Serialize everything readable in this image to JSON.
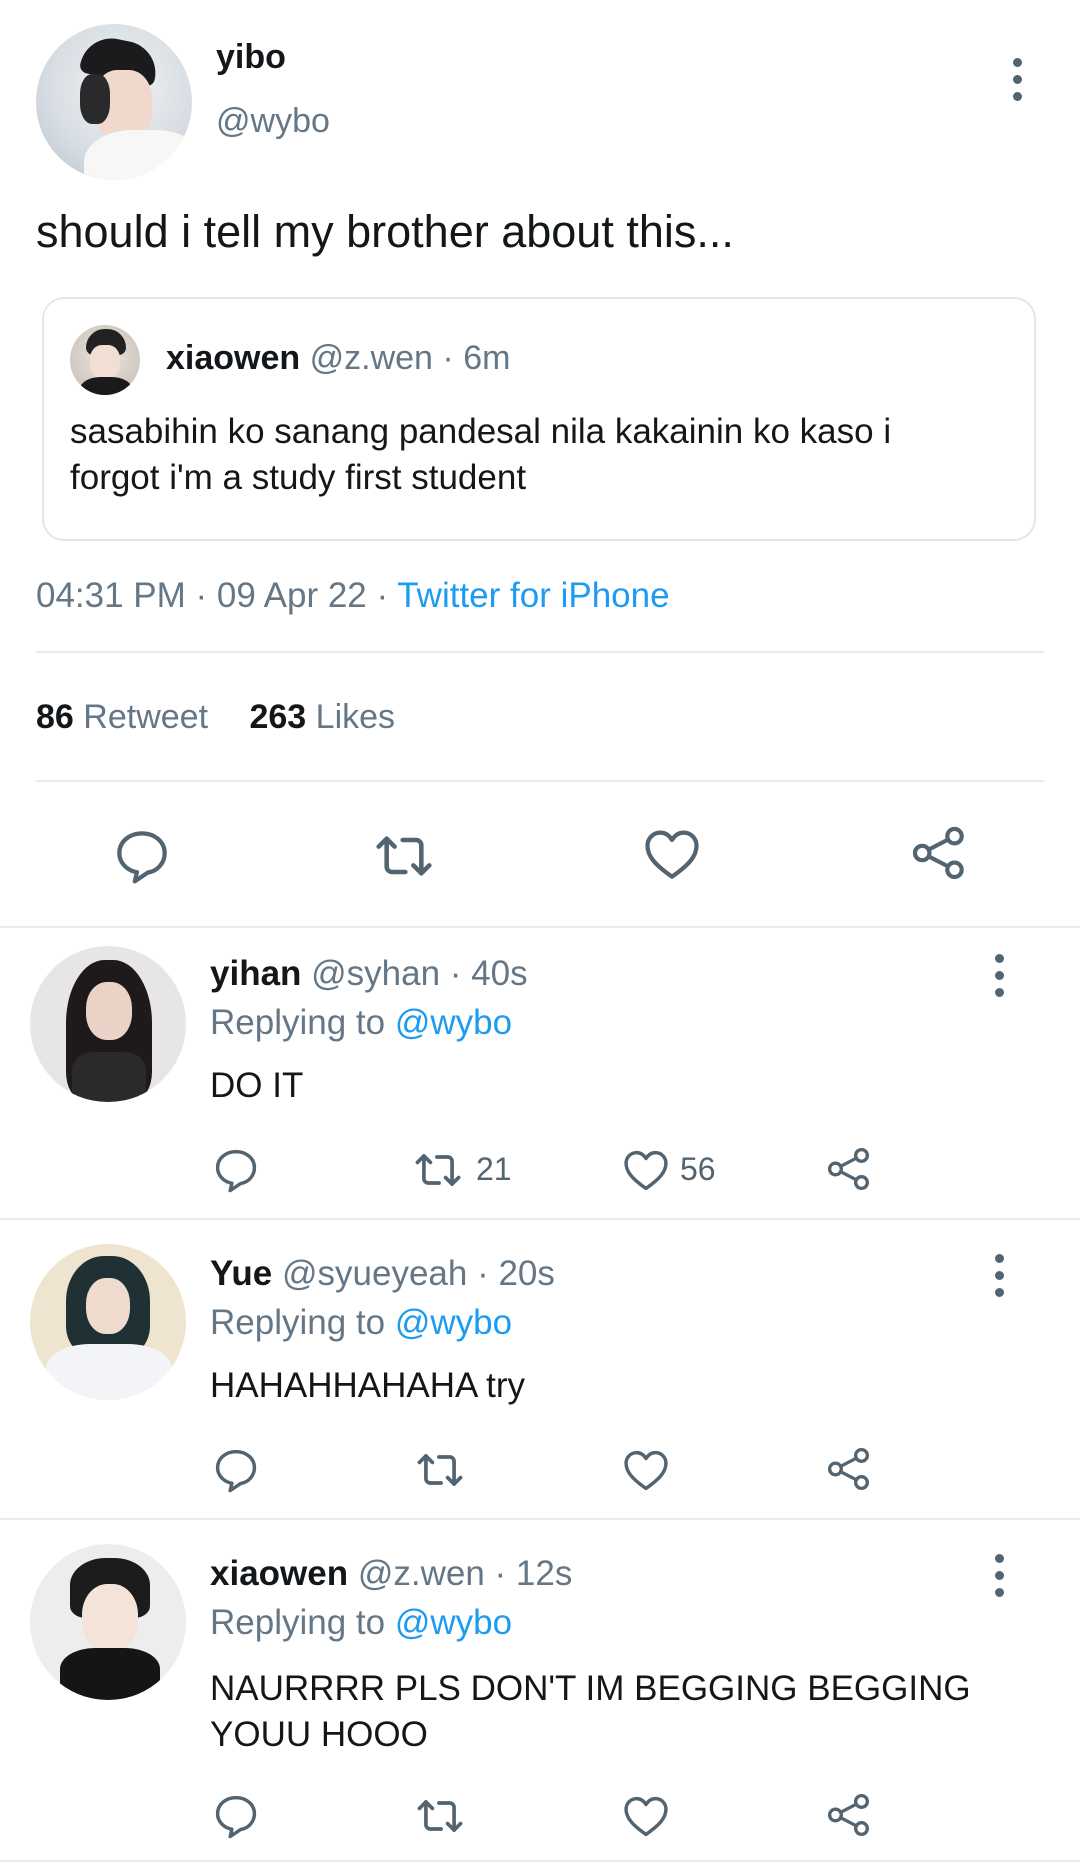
{
  "main_tweet": {
    "name": "yibo",
    "handle": "@wybo",
    "text": "should i tell my brother about this...",
    "quote": {
      "name": "xiaowen",
      "handle": "@z.wen",
      "time": "· 6m",
      "text": "sasabihin ko sanang pandesal nila kakainin ko kaso i forgot i'm a study first student"
    },
    "time": "04:31 PM · 09 Apr 22 ·",
    "source": "Twitter for iPhone",
    "retweet_count": "86",
    "retweet_label": "Retweet",
    "like_count": "263",
    "like_label": "Likes"
  },
  "replies": [
    {
      "name": "yihan",
      "meta": "@syhan · 40s",
      "replying_label": "Replying to",
      "replying_to": "@wybo",
      "text": "DO IT",
      "retweets": "21",
      "likes": "56"
    },
    {
      "name": "Yue",
      "meta": "@syueyeah · 20s",
      "replying_label": "Replying to",
      "replying_to": "@wybo",
      "text": "HAHAHHAHAHA try",
      "retweets": "",
      "likes": ""
    },
    {
      "name": "xiaowen",
      "meta": "@z.wen · 12s",
      "replying_label": "Replying to",
      "replying_to": "@wybo",
      "text": "NAURRRR PLS DON'T IM BEGGING BEGGING YOUU HOOO",
      "retweets": "",
      "likes": ""
    }
  ],
  "colors": {
    "link": "#1d9bf0",
    "muted": "#657786",
    "icon": "#536471",
    "divider": "#e6ecf0"
  },
  "icons": [
    "reply-icon",
    "retweet-icon",
    "like-icon",
    "share-icon",
    "more-options-icon"
  ]
}
